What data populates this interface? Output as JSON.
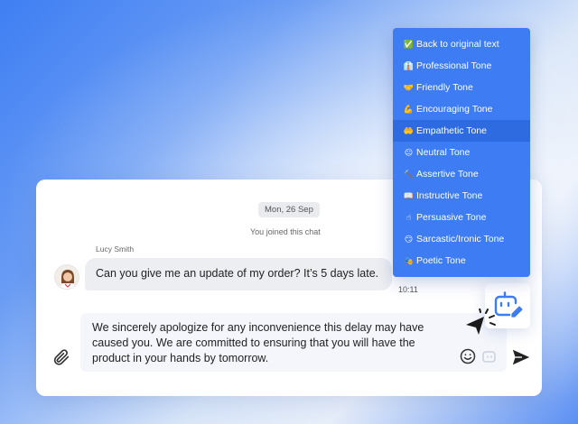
{
  "chat": {
    "date": "Mon, 26 Sep",
    "system_message": "You joined this chat",
    "sender": "Lucy Smith",
    "incoming_message": "Can you give me an update of my order? It’s 5 days late.",
    "incoming_time": "10:11",
    "draft": "We sincerely apologize for any inconvenience this delay may have caused you. We are committed to ensuring that you will have the product in your hands by tomorrow."
  },
  "tone_menu": {
    "items": [
      {
        "emoji": "✅",
        "label": "Back to original text"
      },
      {
        "emoji": "👔",
        "label": "Professional Tone"
      },
      {
        "emoji": "🤝",
        "label": "Friendly Tone"
      },
      {
        "emoji": "💪",
        "label": "Encouraging Tone"
      },
      {
        "emoji": "🤲",
        "label": "Empathetic Tone"
      },
      {
        "emoji": "😐",
        "label": "Neutral Tone"
      },
      {
        "emoji": "🔨",
        "label": "Assertive Tone"
      },
      {
        "emoji": "📖",
        "label": "Instructive Tone"
      },
      {
        "emoji": "☝",
        "label": "Persuasive Tone"
      },
      {
        "emoji": "😏",
        "label": "Sarcastic/Ironic Tone"
      },
      {
        "emoji": "🎭",
        "label": "Poetic Tone"
      }
    ],
    "active_index": 4
  },
  "icons": {
    "attach": "paperclip-icon",
    "emoji": "smiley-icon",
    "send": "send-icon",
    "ai": "ai-assistant-icon"
  },
  "colors": {
    "accent": "#3d7cf2",
    "menu_active": "#2f6be0",
    "bubble": "#eceef1",
    "composer": "#f4f6fb"
  }
}
